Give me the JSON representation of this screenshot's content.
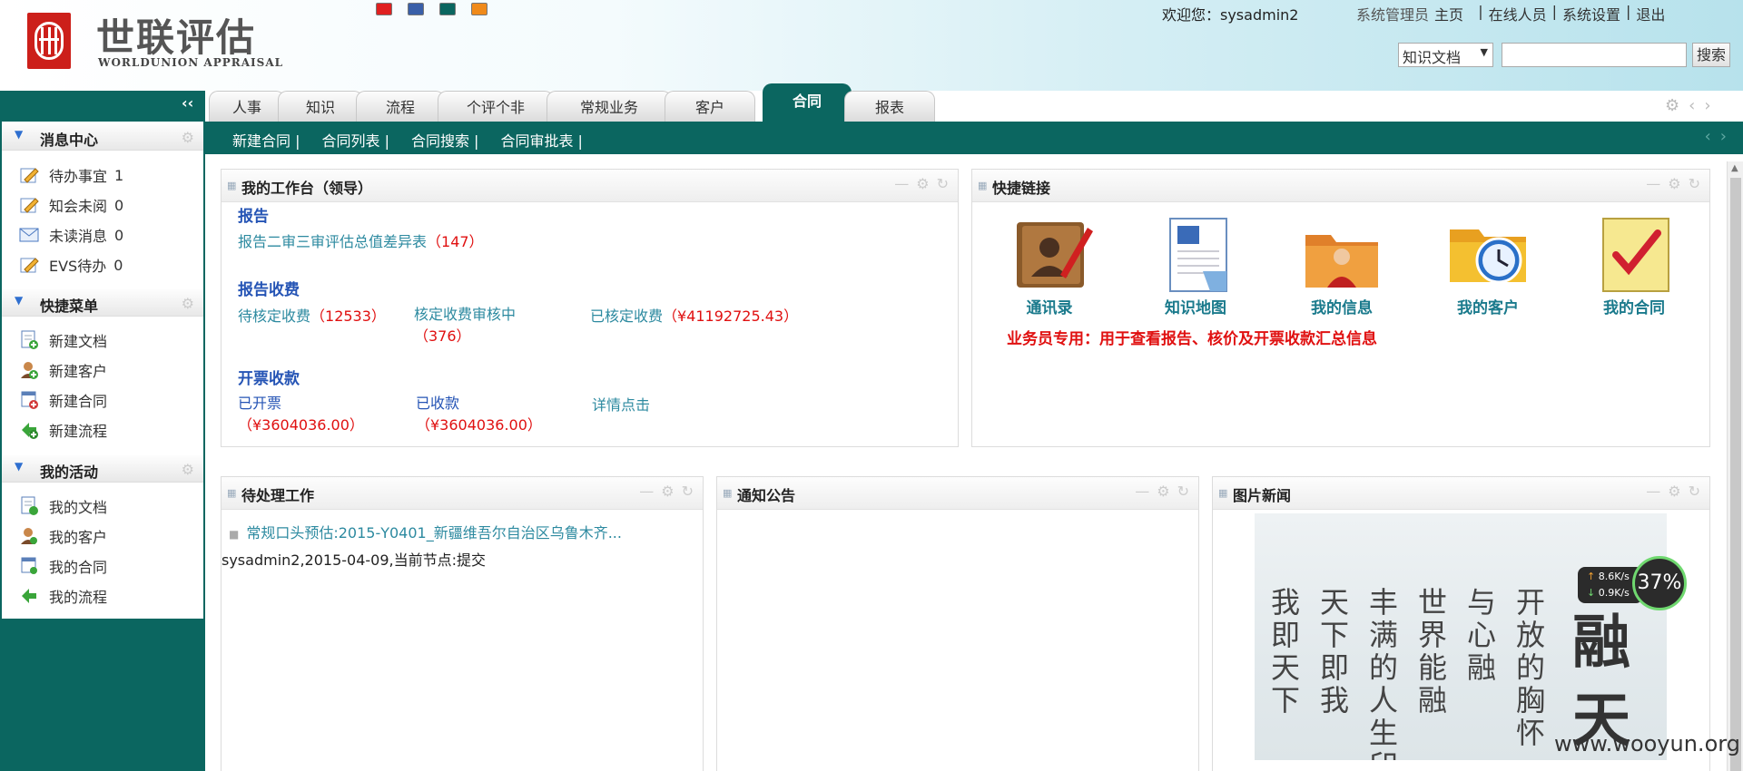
{
  "header": {
    "logo_cn": "世联评估",
    "logo_en": "WORLDUNION APPRAISAL",
    "swatch_colors": [
      "#e02020",
      "#3a5fa8",
      "#0b6660",
      "#f08a1a"
    ],
    "welcome": "欢迎您：sysadmin2",
    "role": "系统管理员",
    "links": [
      "主页",
      "在线人员",
      "系统设置",
      "退出"
    ],
    "search_select": "知识文档",
    "search_button": "搜索"
  },
  "nav": {
    "collapse": "‹‹",
    "tabs": [
      "人事",
      "知识",
      "流程",
      "个评个非",
      "常规业务",
      "客户",
      "合同",
      "报表"
    ],
    "active_tab": "合同"
  },
  "subnav": {
    "links": [
      "新建合同 |",
      "合同列表 |",
      "合同搜索 |",
      "合同审批表 |"
    ]
  },
  "sidebar": {
    "sections": [
      {
        "title": "消息中心",
        "items": [
          {
            "label": "待办事宜",
            "value": "1",
            "icon": "pencil-note-icon"
          },
          {
            "label": "知会未阅",
            "value": "0",
            "icon": "pencil-note-icon"
          },
          {
            "label": "未读消息",
            "value": "0",
            "icon": "envelope-icon"
          },
          {
            "label": "EVS待办",
            "value": "0",
            "icon": "pencil-note-icon"
          }
        ]
      },
      {
        "title": "快捷菜单",
        "items": [
          {
            "label": "新建文档",
            "icon": "new-document-icon"
          },
          {
            "label": "新建客户",
            "icon": "new-customer-icon"
          },
          {
            "label": "新建合同",
            "icon": "new-contract-icon"
          },
          {
            "label": "新建流程",
            "icon": "new-workflow-icon"
          }
        ]
      },
      {
        "title": "我的活动",
        "items": [
          {
            "label": "我的文档",
            "icon": "document-icon"
          },
          {
            "label": "我的客户",
            "icon": "customer-icon"
          },
          {
            "label": "我的合同",
            "icon": "contract-icon"
          },
          {
            "label": "我的流程",
            "icon": "workflow-icon"
          }
        ]
      }
    ]
  },
  "workbench": {
    "title": "我的工作台（领导）",
    "report_title": "报告",
    "report_link": "报告二审三审评估总值差异表",
    "report_count": "（147）",
    "fee_title": "报告收费",
    "fee_pending_label": "待核定收费",
    "fee_pending_value": "（12533）",
    "fee_review_label": "核定收费审核中",
    "fee_review_value": "（376）",
    "fee_done_label": "已核定收费",
    "fee_done_value": "（¥41192725.43）",
    "invoice_title": "开票收款",
    "invoiced_label": "已开票",
    "invoiced_value": "（¥3604036.00）",
    "received_label": "已收款",
    "received_value": "（¥3604036.00）",
    "details_link": "详情点击"
  },
  "quicklinks": {
    "title": "快捷链接",
    "items": [
      "通讯录",
      "知识地图",
      "我的信息",
      "我的客户",
      "我的合同"
    ],
    "note": "业务员专用：用于查看报告、核价及开票收款汇总信息"
  },
  "pending": {
    "title": "待处理工作",
    "item_link": "常规口头预估:2015-Y0401_新疆维吾尔自治区乌鲁木齐...",
    "item_meta": "sysadmin2,2015-04-09,当前节点:提交"
  },
  "notice": {
    "title": "通知公告"
  },
  "news": {
    "title": "图片新闻",
    "columns": [
      "我即天下",
      "天下即我",
      "丰满的人生印",
      "世界能融",
      "与心融",
      "开放的胸怀"
    ],
    "big_text": "融天"
  },
  "speed_widget": {
    "up": "8.6K/s",
    "down": "0.9K/s",
    "percent": "37%"
  },
  "watermark": "www.wooyun.org"
}
